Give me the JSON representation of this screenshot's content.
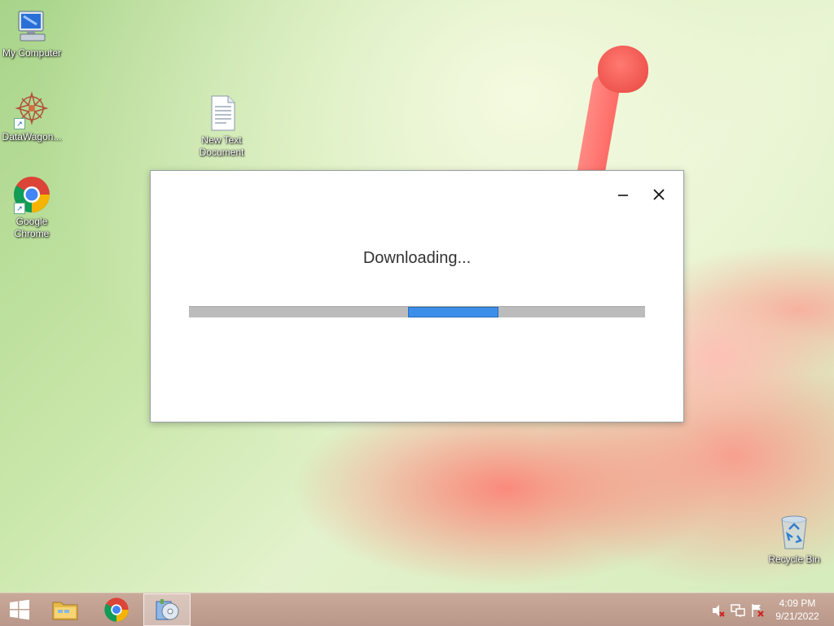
{
  "desktop": {
    "icons": [
      {
        "label": "My Computer"
      },
      {
        "label": "DataWagon..."
      },
      {
        "label": "Google Chrome"
      },
      {
        "label": "New Text Document"
      },
      {
        "label": "Recycle Bin"
      }
    ]
  },
  "dialog": {
    "title": "Downloading...",
    "minimize_label": "—",
    "close_label": "✕"
  },
  "taskbar": {
    "clock_time": "4:09 PM",
    "clock_date": "9/21/2022"
  },
  "colors": {
    "accent": "#3c8fe8",
    "taskbar": "#b9978a"
  }
}
